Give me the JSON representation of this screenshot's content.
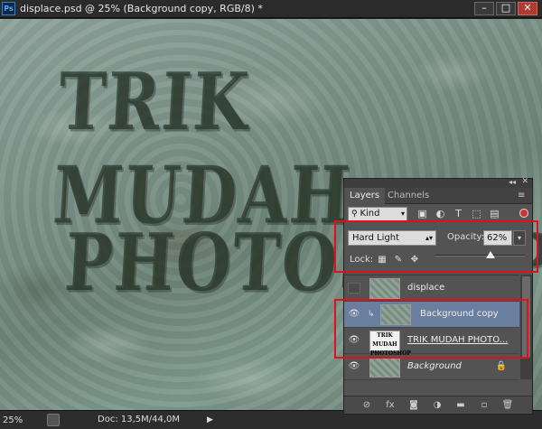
{
  "window": {
    "app_logo": "Ps",
    "title": "displace.psd @ 25% (Background copy, RGB/8) *",
    "min_label": "–",
    "max_label": "□",
    "close_label": "✕"
  },
  "canvas": {
    "line1": "TRIK MUDAH",
    "line2": "PHOTOSHOP"
  },
  "statusbar": {
    "zoom": "25%",
    "doc_info": "Doc: 13,5M/44,0M",
    "arrow": "▶"
  },
  "layers_panel": {
    "collapse_label": "◂◂",
    "close_label": "✕",
    "tabs": [
      {
        "label": "Layers",
        "active": true
      },
      {
        "label": "Channels",
        "active": false
      }
    ],
    "menu_icon": "≡",
    "filter": {
      "kind_label": "Kind",
      "icons": [
        "image-filter-icon",
        "adjustment-filter-icon",
        "type-filter-icon",
        "shape-filter-icon",
        "smart-object-filter-icon"
      ]
    },
    "blend_mode": "Hard Light",
    "opacity_label": "Opacity:",
    "opacity_value": "62%",
    "opacity_fraction": 0.62,
    "lock_label": "Lock:",
    "layers": [
      {
        "name": "displace",
        "visible": false,
        "selected": false
      },
      {
        "name": "Background copy",
        "visible": true,
        "selected": true,
        "clipped": true
      },
      {
        "name": "TRIK MUDAH    PHOTO...",
        "visible": true,
        "selected": false,
        "type_layer": true,
        "thumb_text": "TRIK MUDAH PHOTOSHOP"
      },
      {
        "name": "Background",
        "visible": true,
        "selected": false,
        "locked": true
      }
    ]
  },
  "colors": {
    "highlight": "#e0101a",
    "selected_layer": "#6a7ea0",
    "panel_bg": "#535353"
  }
}
